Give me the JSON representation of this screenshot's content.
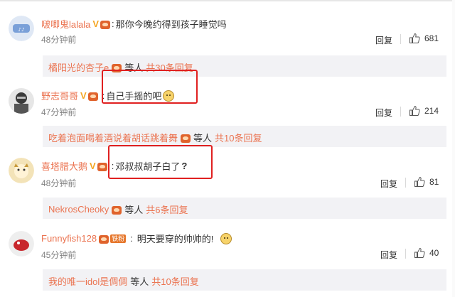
{
  "comments": [
    {
      "username": "啵唧鬼lalala",
      "text": "那你今晚约得到孩子睡觉吗",
      "time": "48分钟前",
      "reply_label": "回复",
      "likes": "681",
      "sub": {
        "name": "橘阳光的杏子e",
        "deng": "等人",
        "count": "共30条回复"
      }
    },
    {
      "username": "野志哥哥",
      "text": "自己手摇的吧",
      "time": "47分钟前",
      "reply_label": "回复",
      "likes": "214",
      "sub": {
        "name": "吃着泡面喝着酒说着胡话跳着舞",
        "deng": "等人",
        "count": "共10条回复"
      }
    },
    {
      "username": "喜塔腊大鹅",
      "text": "邓叔叔胡子白了",
      "text_suffix": "?",
      "time": "48分钟前",
      "reply_label": "回复",
      "likes": "81",
      "sub": {
        "name": "NekrosCheoky",
        "deng": "等人",
        "count": "共6条回复"
      }
    },
    {
      "username": "Funnyfish128",
      "member_badge": "铁粉",
      "text": "明天要穿的帅帅的!",
      "time": "45分钟前",
      "reply_label": "回复",
      "likes": "40",
      "sub": {
        "name": "我的唯一idol是倜倜",
        "deng": "等人",
        "count": "共10条回复"
      }
    }
  ],
  "colors": {
    "username": "#eb7350",
    "highlight_box": "#e02020",
    "sub_bg": "#f2f2f5"
  },
  "icons": [
    "verified-v-icon",
    "fan-badge-icon",
    "thumbs-up-icon",
    "emoji-icon"
  ]
}
